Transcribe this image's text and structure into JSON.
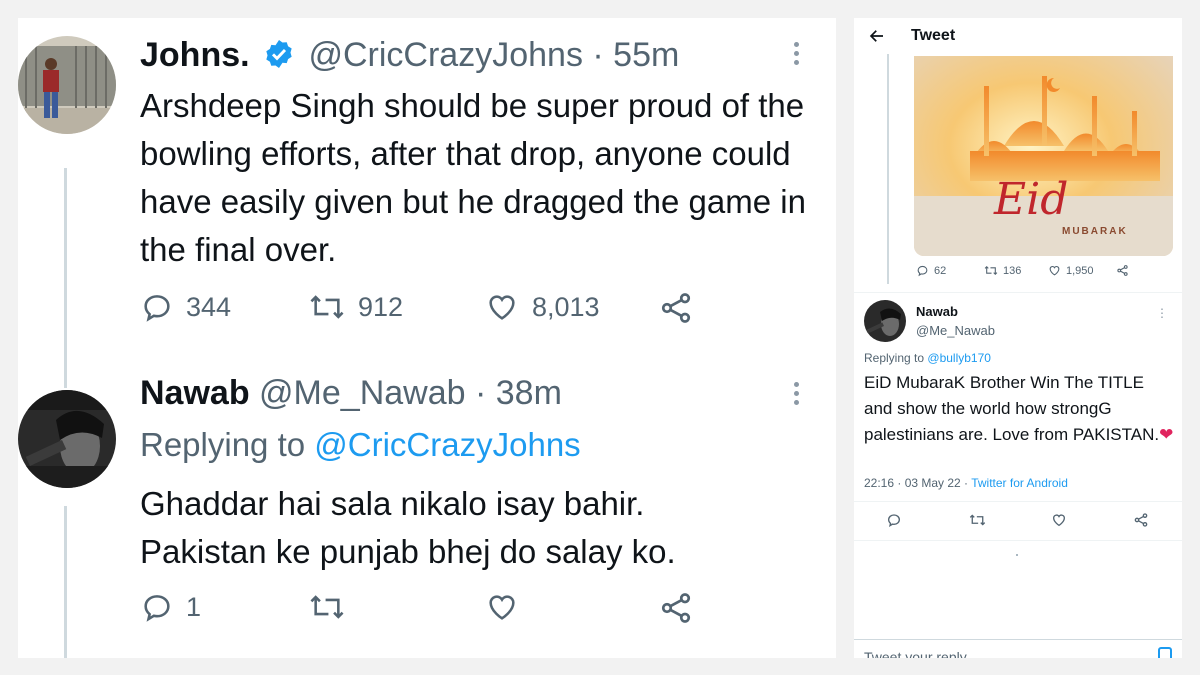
{
  "left_panel": {
    "tweet1": {
      "name": "Johns.",
      "handle": "@CricCrazyJohns",
      "time": "· 55m",
      "text": "Arshdeep Singh should be super proud of the bowling efforts, after that drop, anyone could have easily given but he dragged the game in the final over.",
      "replies": "344",
      "retweets": "912",
      "likes": "8,013"
    },
    "tweet2": {
      "name": "Nawab",
      "handle": "@Me_Nawab",
      "time": "· 38m",
      "replying_prefix": "Replying to",
      "replying_handle": "@CricCrazyJohns",
      "text_line1": "Ghaddar hai sala nikalo isay bahir.",
      "text_line2": "Pakistan ke punjab bhej do salay ko.",
      "replies": "1"
    }
  },
  "right_panel": {
    "header_title": "Tweet",
    "image_text": "Eid",
    "image_subtext": "MUBARAK",
    "parent_actions": {
      "replies": "62",
      "retweets": "136",
      "likes": "1,950"
    },
    "reply": {
      "name": "Nawab",
      "handle": "@Me_Nawab",
      "replying_prefix": "Replying to",
      "replying_handle": "@bullyb170",
      "text": "EiD MubaraK Brother Win The TITLE and show the world how strongG palestinians are. Love from PAKISTAN.",
      "heart": "❤",
      "timestamp": "22:16 · 03 May 22 ·",
      "source": "Twitter for Android"
    },
    "reply_box_placeholder": "Tweet your reply"
  },
  "colors": {
    "accent": "#1d9bf0",
    "text_primary": "#0f1419",
    "text_secondary": "#536471",
    "heart": "#e0245e"
  }
}
